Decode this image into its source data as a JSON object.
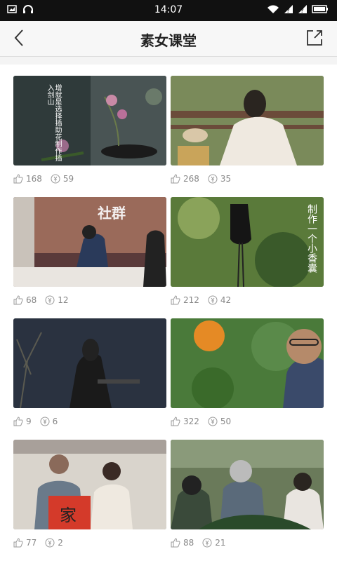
{
  "status": {
    "time": "14:07"
  },
  "header": {
    "title": "素女课堂"
  },
  "cards": [
    {
      "likes": "168",
      "views": "59"
    },
    {
      "likes": "268",
      "views": "35"
    },
    {
      "likes": "68",
      "views": "12"
    },
    {
      "likes": "212",
      "views": "42"
    },
    {
      "likes": "9",
      "views": "6"
    },
    {
      "likes": "322",
      "views": "50"
    },
    {
      "likes": "77",
      "views": "2"
    },
    {
      "likes": "88",
      "views": "21"
    }
  ],
  "thumb_texts": {
    "card0": "增就是选择插助花制作插入剑山",
    "card3": "制作一个小香囊",
    "card6": "家"
  }
}
